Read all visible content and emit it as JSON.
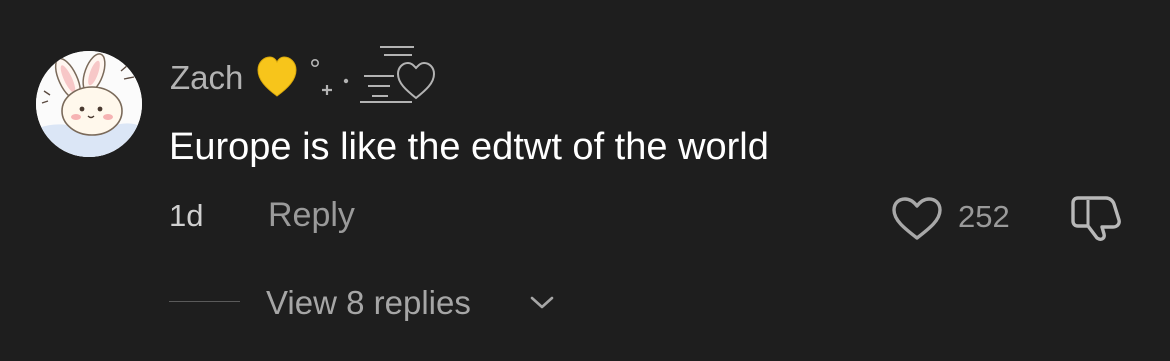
{
  "comment": {
    "username": "Zach",
    "username_decoration": "💛°₊·",
    "text": "Europe is like the edtwt of the world",
    "time_ago": "1d",
    "reply_label": "Reply",
    "like_count": "252",
    "view_replies_label": "View 8 replies"
  },
  "icons": {
    "avatar": "avatar-bunny",
    "like": "heart-outline-icon",
    "dislike": "thumbs-down-icon",
    "expand": "chevron-down-icon"
  },
  "colors": {
    "background": "#1e1e1e",
    "text_primary": "#ffffff",
    "text_secondary": "#9a9a9a",
    "heart_emoji": "#f5c518"
  }
}
